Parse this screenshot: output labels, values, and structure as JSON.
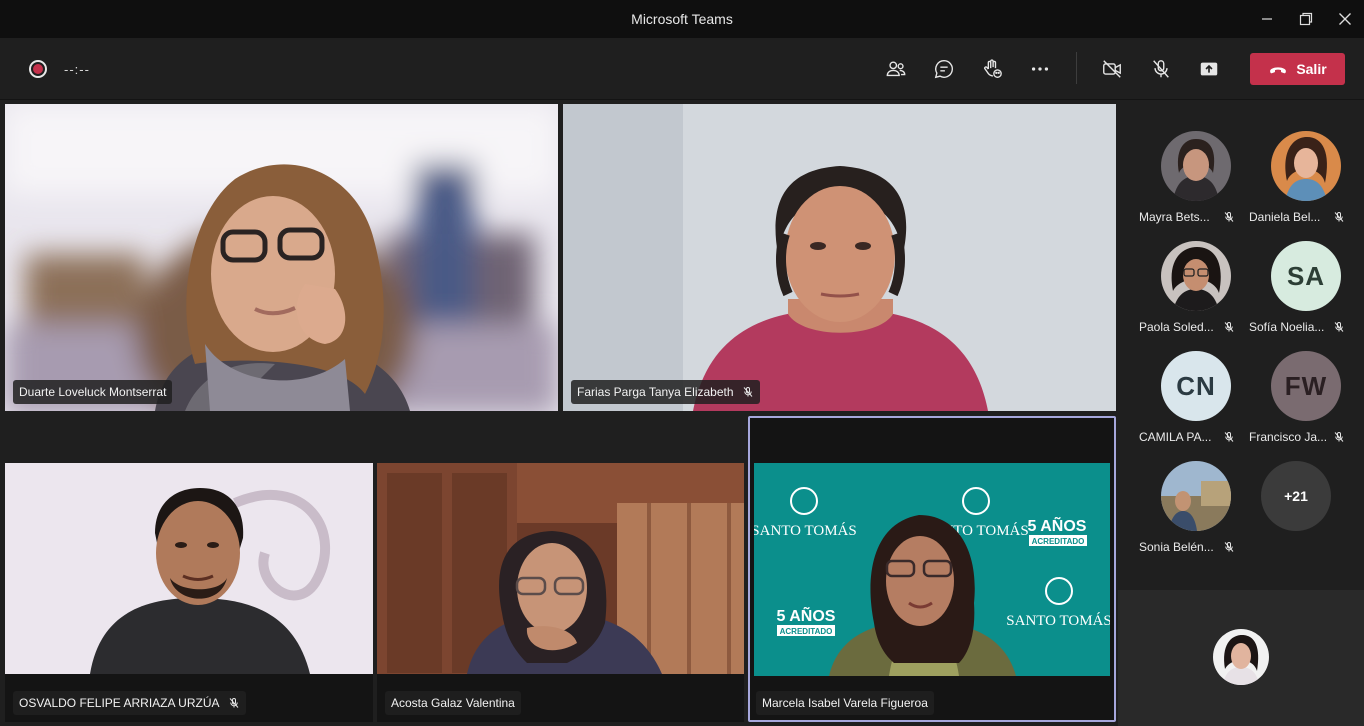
{
  "window": {
    "title": "Microsoft Teams",
    "controls": [
      "minimize-icon",
      "restore-icon",
      "close-icon"
    ]
  },
  "toolbar": {
    "recording_icon": "record-icon",
    "timer": "--:--",
    "buttons": [
      {
        "name": "participants",
        "icon": "people-icon"
      },
      {
        "name": "chat",
        "icon": "chat-icon"
      },
      {
        "name": "reactions",
        "icon": "raise-hand-icon"
      },
      {
        "name": "more",
        "icon": "more-icon"
      },
      {
        "name": "camera",
        "icon": "camera-off-icon"
      },
      {
        "name": "mic",
        "icon": "mic-off-icon"
      },
      {
        "name": "share",
        "icon": "share-tray-icon"
      }
    ],
    "leave_label": "Salir",
    "leave_color": "#c4314b"
  },
  "stage": {
    "tiles": [
      {
        "name": "Duarte Loveluck Montserrat",
        "muted": false
      },
      {
        "name": "Farias Parga Tanya Elizabeth",
        "muted": true
      },
      {
        "name": "OSVALDO FELIPE ARRIAZA URZÚA",
        "muted": true
      },
      {
        "name": "Acosta Galaz Valentina",
        "muted": false
      },
      {
        "name": "Marcela Isabel Varela Figueroa",
        "muted": false,
        "active_speaker": true
      }
    ],
    "speaker_background": {
      "brand": "SANTO TOMÁS",
      "badge_top": "5 AÑOS",
      "badge_bottom": "ACREDITADO",
      "brand_color": "#0b8f8c"
    }
  },
  "roster": {
    "people": [
      {
        "name": "Mayra Bets...",
        "muted": true,
        "type": "photo"
      },
      {
        "name": "Daniela Bel...",
        "muted": true,
        "type": "photo"
      },
      {
        "name": "Paola Soled...",
        "muted": true,
        "type": "photo"
      },
      {
        "name": "Sofía Noelia...",
        "muted": true,
        "type": "initials",
        "initials": "SA",
        "bg": "#d7ebdf",
        "fg": "#2c3e35"
      },
      {
        "name": "CAMILA PA...",
        "muted": true,
        "type": "initials",
        "initials": "CN",
        "bg": "#d9e6ec",
        "fg": "#2b3a42"
      },
      {
        "name": "Francisco Ja...",
        "muted": true,
        "type": "initials",
        "initials": "FW",
        "bg": "#7a6b70",
        "fg": "#2a1f22"
      },
      {
        "name": "Sonia Belén...",
        "muted": true,
        "type": "photo"
      }
    ],
    "overflow": "+21"
  },
  "self_view": {
    "icon": "self-avatar"
  }
}
